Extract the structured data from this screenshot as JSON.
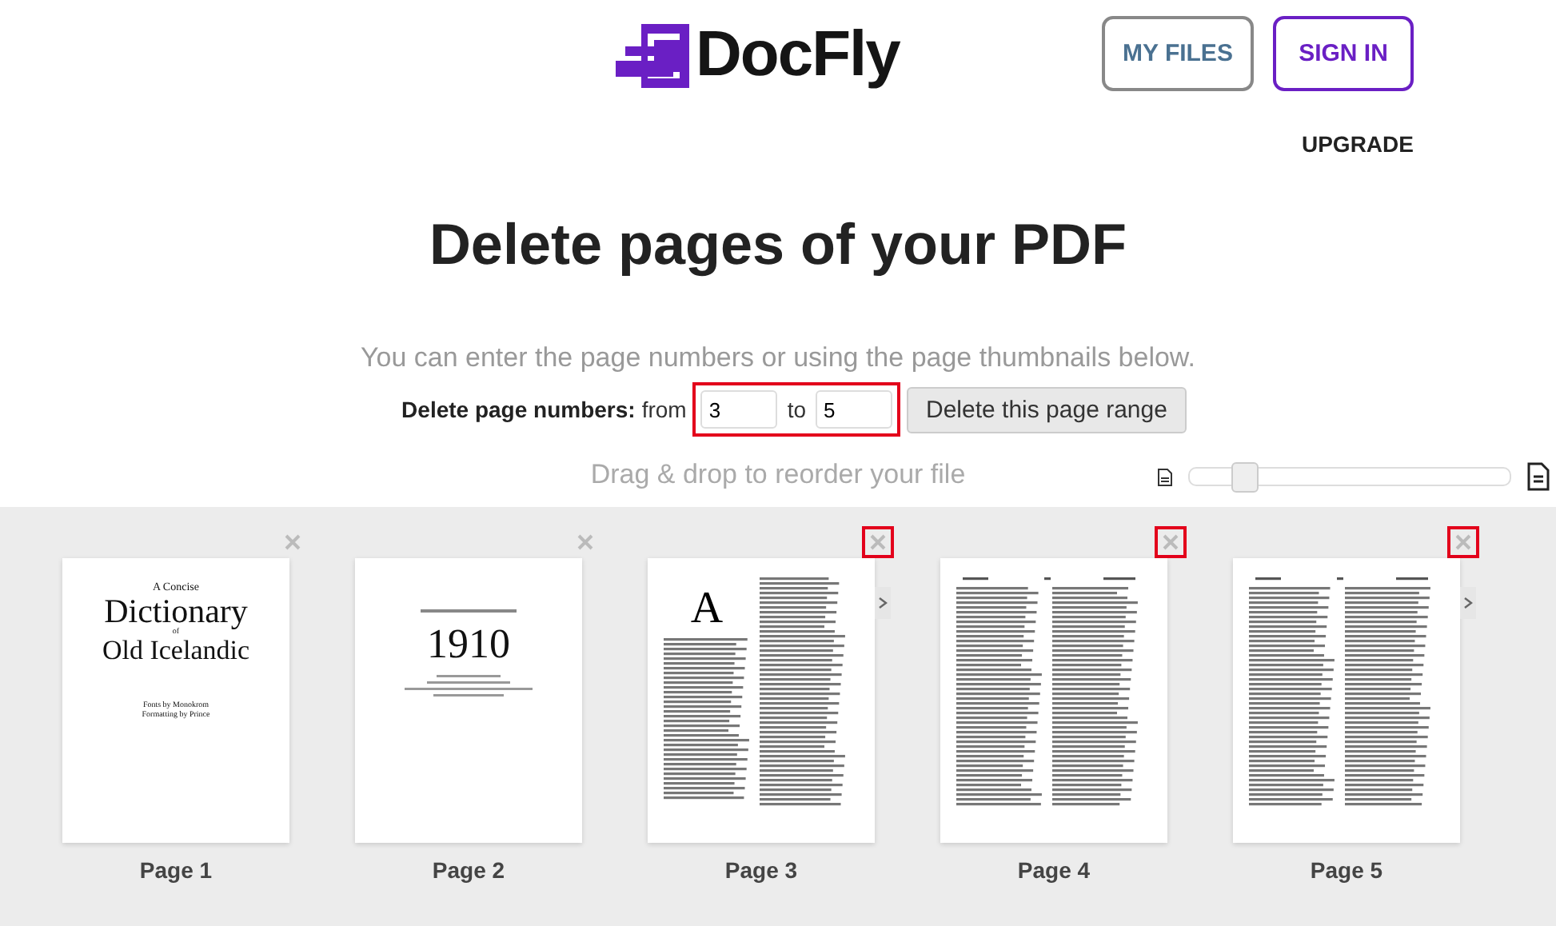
{
  "header": {
    "logo": "DocFly",
    "buttons": [
      {
        "label": "MY FILES",
        "kind": "plain"
      },
      {
        "label": "SIGN IN",
        "kind": "accent"
      }
    ],
    "upgrade": "UPGRADE"
  },
  "title": "Delete pages of your PDF",
  "subtitle": "You can enter the page numbers or using the page thumbnails below.",
  "range_form": {
    "label": "Delete page numbers:",
    "from_label": "from",
    "from_value": "3",
    "to_label": "to",
    "to_value": "5",
    "button": "Delete this page range",
    "highlighted": true
  },
  "reorder": {
    "hint": "Drag & drop to reorder your file",
    "zoom": {
      "level": 0.17
    }
  },
  "pages": [
    {
      "label": "Page 1",
      "selected": false,
      "side_tab": false,
      "kind": "title",
      "lines": [
        "A Concise",
        "Dictionary",
        "of",
        "Old Icelandic",
        "Fonts by Monokrom",
        "Formatting by Prince"
      ]
    },
    {
      "label": "Page 2",
      "selected": false,
      "side_tab": false,
      "kind": "year",
      "lines": [
        "1910"
      ]
    },
    {
      "label": "Page 3",
      "selected": true,
      "side_tab": true,
      "kind": "letter",
      "lines": [
        "A"
      ]
    },
    {
      "label": "Page 4",
      "selected": true,
      "side_tab": false,
      "kind": "columns"
    },
    {
      "label": "Page 5",
      "selected": true,
      "side_tab": true,
      "kind": "columns"
    }
  ]
}
